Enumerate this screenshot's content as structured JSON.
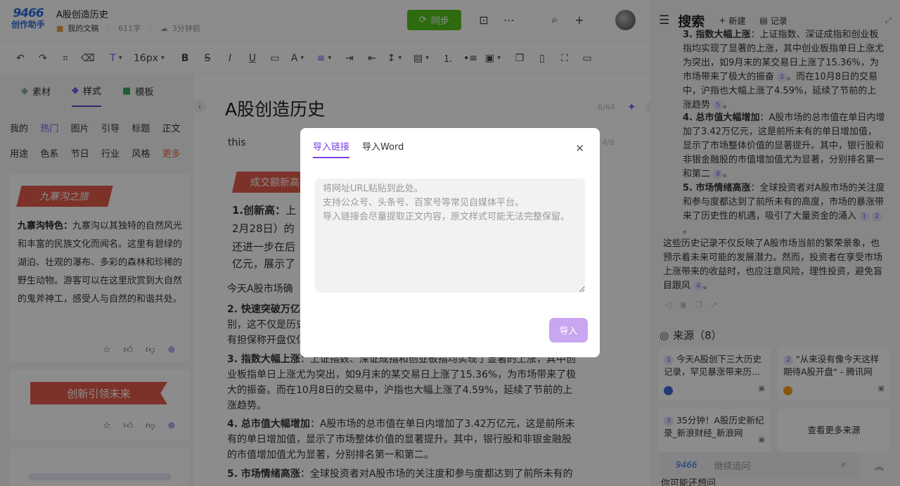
{
  "header": {
    "logo_top": "9466",
    "logo_bottom": "创作助手",
    "doc_title": "A股创造历史",
    "folder": "我的文稿",
    "word_count": "611字",
    "saved": "3分钟前",
    "sync_label": "同步"
  },
  "toolbar": {
    "font_size": "16px"
  },
  "left_panel": {
    "tabs": [
      "素材",
      "样式",
      "模板"
    ],
    "categories_row1": [
      "我的",
      "热门",
      "图片",
      "引导",
      "标题",
      "正文"
    ],
    "categories_row2": [
      "用途",
      "色系",
      "节日",
      "行业",
      "风格",
      "更多"
    ],
    "card1_banner": "九寨沟之旅",
    "card1_bold": "九寨沟特色：",
    "card1_text": "九寨沟以其独特的自然风光和丰富的民族文化而闻名。这里有碧绿的湖泊、壮观的瀑布、多彩的森林和珍稀的野生动物。游客可以在这里欣赏到大自然的鬼斧神工，感受人与自然的和谐共处。",
    "card2_banner": "创新引领未来"
  },
  "editor": {
    "title": "A股创造历史",
    "title_counter": "6/64",
    "subtitle": "this",
    "subtitle_counter": "4/8",
    "red_heading": "成交额新高",
    "item1_bold": "1.创新高：",
    "item1_lines": [
      "上",
      "2月28日）的",
      "还进一步在后",
      "亿元，展示了"
    ],
    "para_today": "今天A股市场确",
    "item2_bold": "2. 快速突破万亿",
    "item2_rest_lines": [
      "别，这不仅是历史",
      "有担保称开盘仅亿"
    ],
    "item3_bold": "3. 指数大幅上涨",
    "item3_text": "：上证指数、深证成指和创业板指均实现了显著的上涨，其中创业板指单日上涨尤为突出，如9月末的某交易日上涨了15.36%，为市场带来了极大的振奋。而在10月8日的交易中，沪指也大幅上涨了4.59%，延续了节前的上涨趋势。",
    "item4_bold": "4. 总市值大幅增加",
    "item4_text": "：A股市场的总市值在单日内增加了3.42万亿元，这是前所未有的单日增加值，显示了市场整体价值的显著提升。其中，银行股和非银金融股的市值增加值尤为显著，分别排名第一和第二。",
    "item5_bold": "5. 市场情绪高涨",
    "item5_text": "：全球投资者对A股市场的关注度和参与度都达到了前所未有的"
  },
  "right_panel": {
    "title": "搜索",
    "new_label": "新建",
    "record_label": "记录",
    "r3_head": "3. 指数大幅上涨",
    "r3_text": "：上证指数、深证成指和创业板指均实现了显著的上涨，其中创业板指单日上涨尤为突出，如9月末的某交易日上涨了15.36%，为市场带来了极大的振奋",
    "r3_text_b": "。而在10月8日的交易中，沪指也大幅上涨了4.59%，延续了节前的上涨趋势",
    "r4_head": "4. 总市值大幅增加",
    "r4_text": "：A股市场的总市值在单日内增加了3.42万亿元，这是前所未有的单日增加值，显示了市场整体价值的显著提升。其中，银行股和非银金融股的市值增加值尤为显著，分别排名第一和第二",
    "r5_head": "5. 市场情绪高涨",
    "r5_text": "：全球投资者对A股市场的关注度和参与度都达到了前所未有的高度，市场的暴涨带来了历史性的机遇，吸引了大量资金的涌入",
    "summary": "这些历史记录不仅反映了A股市场当前的繁荣景象，也预示着未来可能的发展潜力。然而，投资者在享受市场上涨带来的收益时，也应注意风险，理性投资，避免盲目跟风",
    "sources_label": "来源（8）",
    "sources": [
      {
        "n": "1",
        "text": "今天A股创下三大历史记录，罕见暴涨带来历..."
      },
      {
        "n": "2",
        "text": "\"从来没有像今天这样期待A股开盘\" - 腾讯网"
      },
      {
        "n": "3",
        "text": "35分钟！A股历史新纪录_新浪财经_新浪网"
      }
    ],
    "more_sources": "查看更多来源",
    "follow_logo": "9466",
    "follow_placeholder": "继续追问",
    "bottom_hint": "你可能还想问"
  },
  "modal": {
    "tab_link": "导入链接",
    "tab_word": "导入Word",
    "placeholder": "将网址URL粘贴到此处。\n支持公众号、头条号、百家号等常见自媒体平台。\n导入链接会尽量提取正文内容，原文样式可能无法完整保留。",
    "import_label": "导入"
  }
}
